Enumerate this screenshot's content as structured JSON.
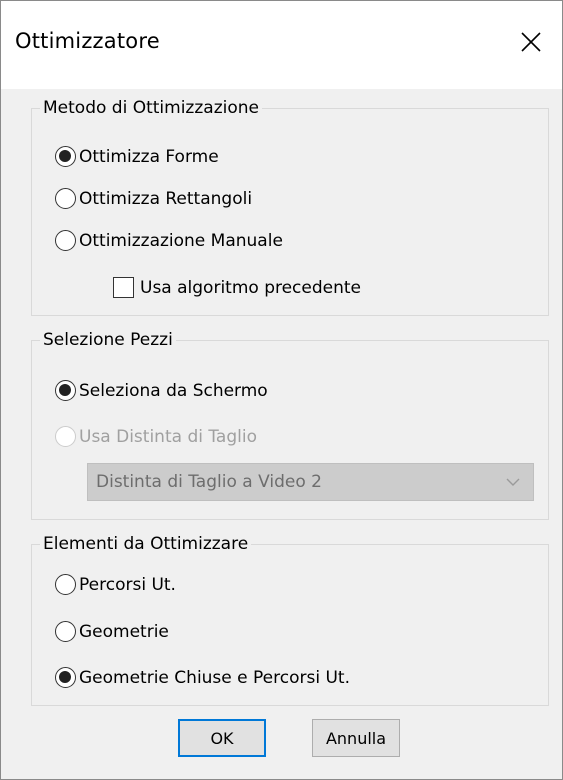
{
  "window": {
    "title": "Ottimizzatore",
    "close_icon": "close-icon"
  },
  "metodo": {
    "legend": "Metodo di Ottimizzazione",
    "options": [
      {
        "label": "Ottimizza Forme",
        "checked": true
      },
      {
        "label": "Ottimizza Rettangoli",
        "checked": false
      },
      {
        "label": "Ottimizzazione Manuale",
        "checked": false
      }
    ],
    "checkbox_label": "Usa algoritmo precedente",
    "checkbox_checked": false
  },
  "selezione": {
    "legend": "Selezione Pezzi",
    "options": [
      {
        "label": "Seleziona da Schermo",
        "checked": true,
        "enabled": true
      },
      {
        "label": "Usa Distinta di Taglio",
        "checked": false,
        "enabled": false
      }
    ],
    "dropdown_value": "Distinta di Taglio a Video 2",
    "dropdown_enabled": false
  },
  "elementi": {
    "legend": "Elementi da Ottimizzare",
    "options": [
      {
        "label": "Percorsi Ut.",
        "checked": false
      },
      {
        "label": "Geometrie",
        "checked": false
      },
      {
        "label": "Geometrie Chiuse e Percorsi Ut.",
        "checked": true
      }
    ]
  },
  "buttons": {
    "ok": "OK",
    "cancel": "Annulla"
  },
  "colors": {
    "dialog_bg": "#f0f0f0",
    "title_bg": "#ffffff",
    "default_button_border": "#0078d7",
    "disabled_text": "#a0a0a0"
  }
}
